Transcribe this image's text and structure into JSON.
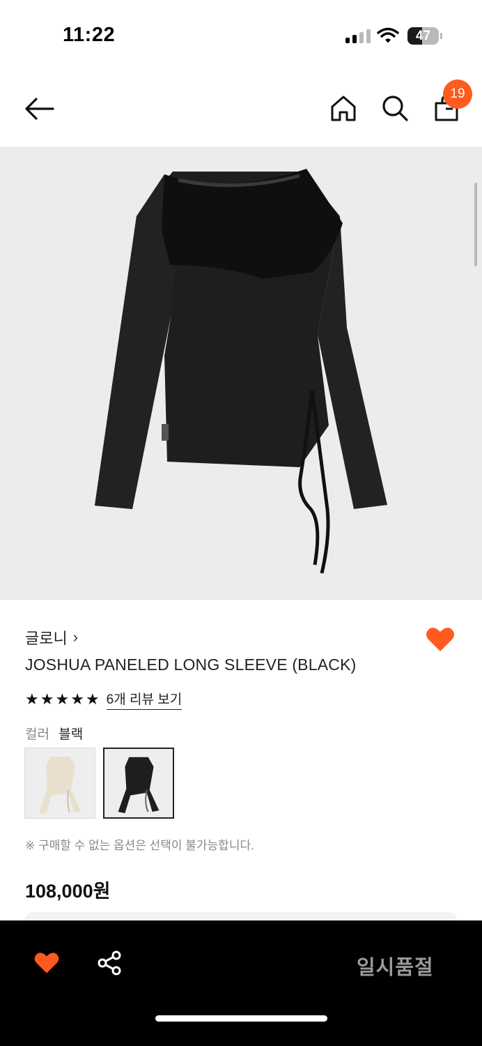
{
  "status": {
    "time": "11:22",
    "battery": "47",
    "battery_level": 0.47
  },
  "header": {
    "icons": [
      "back-arrow-icon",
      "home-icon",
      "search-icon",
      "shopping-bag-icon"
    ],
    "cart_count": "19"
  },
  "product": {
    "brand": "글로니",
    "brand_chevron": "›",
    "name": "JOSHUA PANELED LONG SLEEVE (BLACK)",
    "rating_stars": 5,
    "review_link": "6개 리뷰 보기",
    "color_label": "컬러",
    "color_value": "블랙",
    "swatches": [
      {
        "color": "ivory",
        "selected": false
      },
      {
        "color": "black",
        "selected": true
      }
    ],
    "notice": "※ 구매할 수 없는 옵션은 선택이 불가능합니다.",
    "price": "108,000원",
    "liked": true
  },
  "bottom_bar": {
    "soldout_label": "일시품절",
    "icons": [
      "heart-icon",
      "share-icon"
    ]
  },
  "colors": {
    "accent": "#ff5a1f",
    "garment_black": "#1c1c1c",
    "garment_ivory": "#e9dfcf",
    "image_bg": "#ececec",
    "soldout_text": "#9a9a9a"
  }
}
